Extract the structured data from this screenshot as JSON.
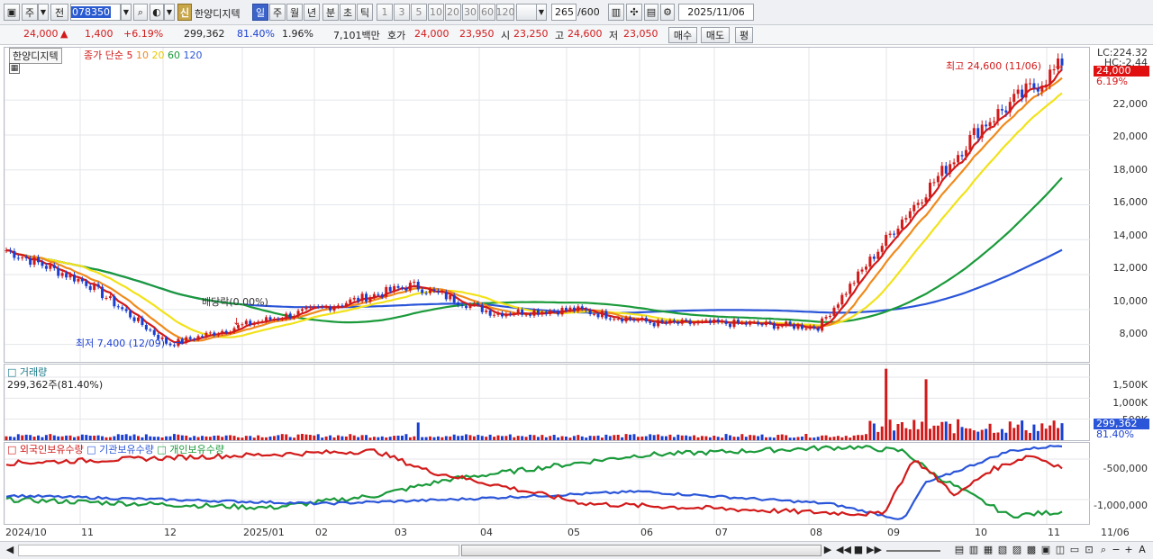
{
  "toolbar": {
    "period_label": "주",
    "prev_label": "전",
    "stock_code": "078350",
    "shin_label": "신",
    "stock_name": "한양디지텍",
    "period_tabs": [
      "일",
      "주",
      "월",
      "년",
      "분",
      "초",
      "틱"
    ],
    "active_tab": "일",
    "interval_buttons": [
      "1",
      "3",
      "5",
      "10",
      "20",
      "30",
      "60",
      "120"
    ],
    "count_value": "265",
    "count_total": "/600",
    "date_value": "2025/11/06"
  },
  "info": {
    "price": "24,000",
    "up_arrow": "▲",
    "change": "1,400",
    "change_pct": "+6.19%",
    "volume": "299,362",
    "volume_ratio": "81.40%",
    "turnover": "1.96%",
    "amount": "7,101백만",
    "ask_label": "호가",
    "ask": "24,000",
    "bid": "23,950",
    "open_label": "시",
    "open": "23,250",
    "high_label": "고",
    "high": "24,600",
    "low_label": "저",
    "low": "23,050",
    "buy_label": "매수",
    "sell_label": "매도",
    "avg_label": "평"
  },
  "price_panel": {
    "name_tag": "한양디지텍",
    "ma_title": "종가 단순",
    "ma_periods": [
      "5",
      "10",
      "20",
      "60",
      "120"
    ],
    "ma_colors": [
      "#d21a1a",
      "#f08a1c",
      "#f2e21a",
      "#1a9a3a",
      "#2a55d8"
    ],
    "lc_label": "LC:224.32",
    "hc_label": "HC:-2.44",
    "current_tag": "24,000",
    "pct_tag": "6.19%",
    "high_annotation": "최고 24,600 (11/06)",
    "low_annotation": "최저 7,400 (12/09)",
    "dividend_annotation": "배당락(0.00%)",
    "y_labels": [
      "22,000",
      "20,000",
      "18,000",
      "16,000",
      "14,000",
      "12,000",
      "10,000",
      "8,000"
    ]
  },
  "volume_panel": {
    "title": "거래량",
    "subtitle": "299,362주(81.40%)",
    "y_labels": [
      "1,500K",
      "1,000K",
      "500K"
    ],
    "current_tag": "299,362",
    "pct_tag": "81.40%"
  },
  "holding_panel": {
    "legends": [
      "외국인보유수량",
      "기관보유수량",
      "개인보유수량"
    ],
    "colors": [
      "#d21a1a",
      "#2a55d8",
      "#1a9a3a"
    ],
    "y_labels": [
      "-500,000",
      "-1,000,000"
    ]
  },
  "x_axis": {
    "labels": [
      "2024/10",
      "11",
      "12",
      "2025/01",
      "02",
      "03",
      "04",
      "05",
      "06",
      "07",
      "08",
      "09",
      "10",
      "11"
    ],
    "end_label": "11/06"
  },
  "chart_data": {
    "type": "candlestick",
    "title": "한양디지텍",
    "price_ylim": [
      7000,
      25000
    ],
    "moving_averages": [
      "5",
      "10",
      "20",
      "60",
      "120"
    ],
    "monthly_closes": {
      "x": [
        "2024/10",
        "11",
        "12",
        "2025/01",
        "02",
        "03",
        "04",
        "05",
        "06",
        "07",
        "08",
        "09",
        "10",
        "11"
      ],
      "close": [
        13400,
        11500,
        8000,
        9200,
        10200,
        11400,
        9800,
        10000,
        9200,
        9200,
        9000,
        15000,
        20500,
        24000
      ]
    },
    "high": {
      "value": 24600,
      "date": "11/06"
    },
    "low": {
      "value": 7400,
      "date": "12/09"
    },
    "volume_ylim": [
      0,
      1800000
    ],
    "volume_last": 299362,
    "holdings_ylim": [
      -1300000,
      -300000
    ]
  }
}
